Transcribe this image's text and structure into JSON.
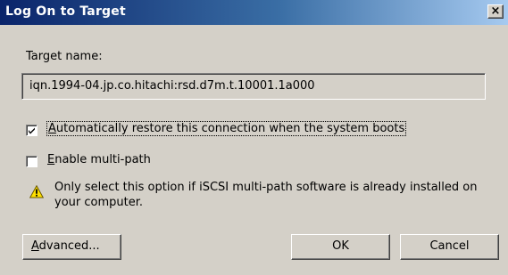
{
  "window": {
    "title": "Log On to Target",
    "close_glyph": "×"
  },
  "target": {
    "label": "Target name:",
    "value": "iqn.1994-04.jp.co.hitachi:rsd.d7m.t.10001.1a000"
  },
  "options": {
    "auto_restore": {
      "checked": true,
      "mnemonic": "A",
      "label_rest": "utomatically restore this connection when the system boots"
    },
    "multipath": {
      "checked": false,
      "mnemonic": "E",
      "label_rest": "nable multi-path"
    }
  },
  "warning": {
    "icon": "warning-icon",
    "text": "Only select this option if iSCSI multi-path software is already installed on your computer."
  },
  "buttons": {
    "advanced_mnemonic": "A",
    "advanced_rest": "dvanced...",
    "ok": "OK",
    "cancel": "Cancel"
  },
  "colors": {
    "titlebar_start": "#0a246a",
    "titlebar_end": "#a6caf0",
    "face": "#d4d0c8"
  }
}
